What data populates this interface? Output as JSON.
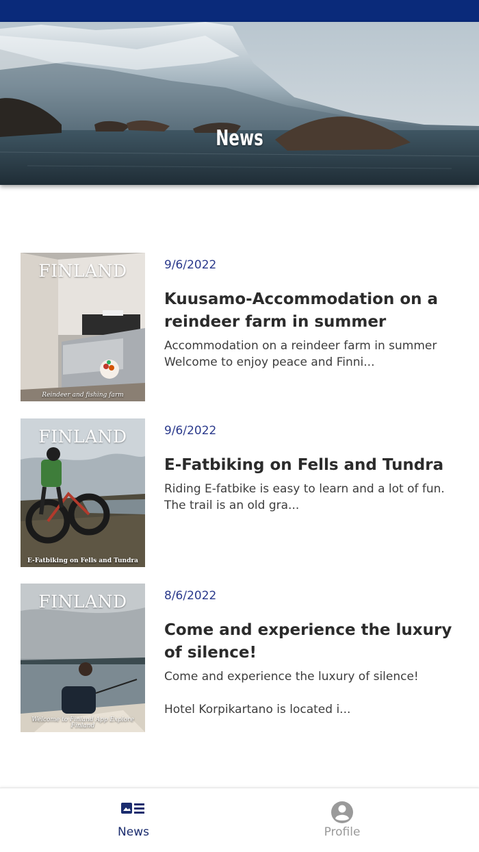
{
  "header": {
    "title": "News"
  },
  "colors": {
    "status_bar": "#0a2a7a",
    "accent": "#1a2c6e",
    "date": "#2b3a8c",
    "inactive": "#9a9a9a"
  },
  "news": [
    {
      "date": "9/6/2022",
      "title": "Kuusamo-Accommodation on a reindeer farm in summer",
      "description": "Accommodation on a reindeer farm in summer\nWelcome to enjoy peace and Finni...",
      "cover": {
        "masthead": "FINLAND",
        "caption": "Reindeer and fishing farm"
      }
    },
    {
      "date": "9/6/2022",
      "title": "E-Fatbiking on Fells and Tundra",
      "description": "Riding E-fatbike is easy to learn and a lot of fun. The trail is an old gra...",
      "cover": {
        "masthead": "FINLAND",
        "caption": "E-Fatbiking on Fells and Tundra"
      }
    },
    {
      "date": "8/6/2022",
      "title": "Come and experience the luxury of silence!",
      "description": "Come and experience the luxury of silence!\n\nHotel Korpikartano is located i...",
      "cover": {
        "masthead": "FINLAND",
        "caption": "Welcome to Finland App Explore Finland"
      }
    }
  ],
  "bottom_nav": [
    {
      "label": "News",
      "icon": "news-icon",
      "active": true
    },
    {
      "label": "Profile",
      "icon": "account-circle-icon",
      "active": false
    }
  ]
}
